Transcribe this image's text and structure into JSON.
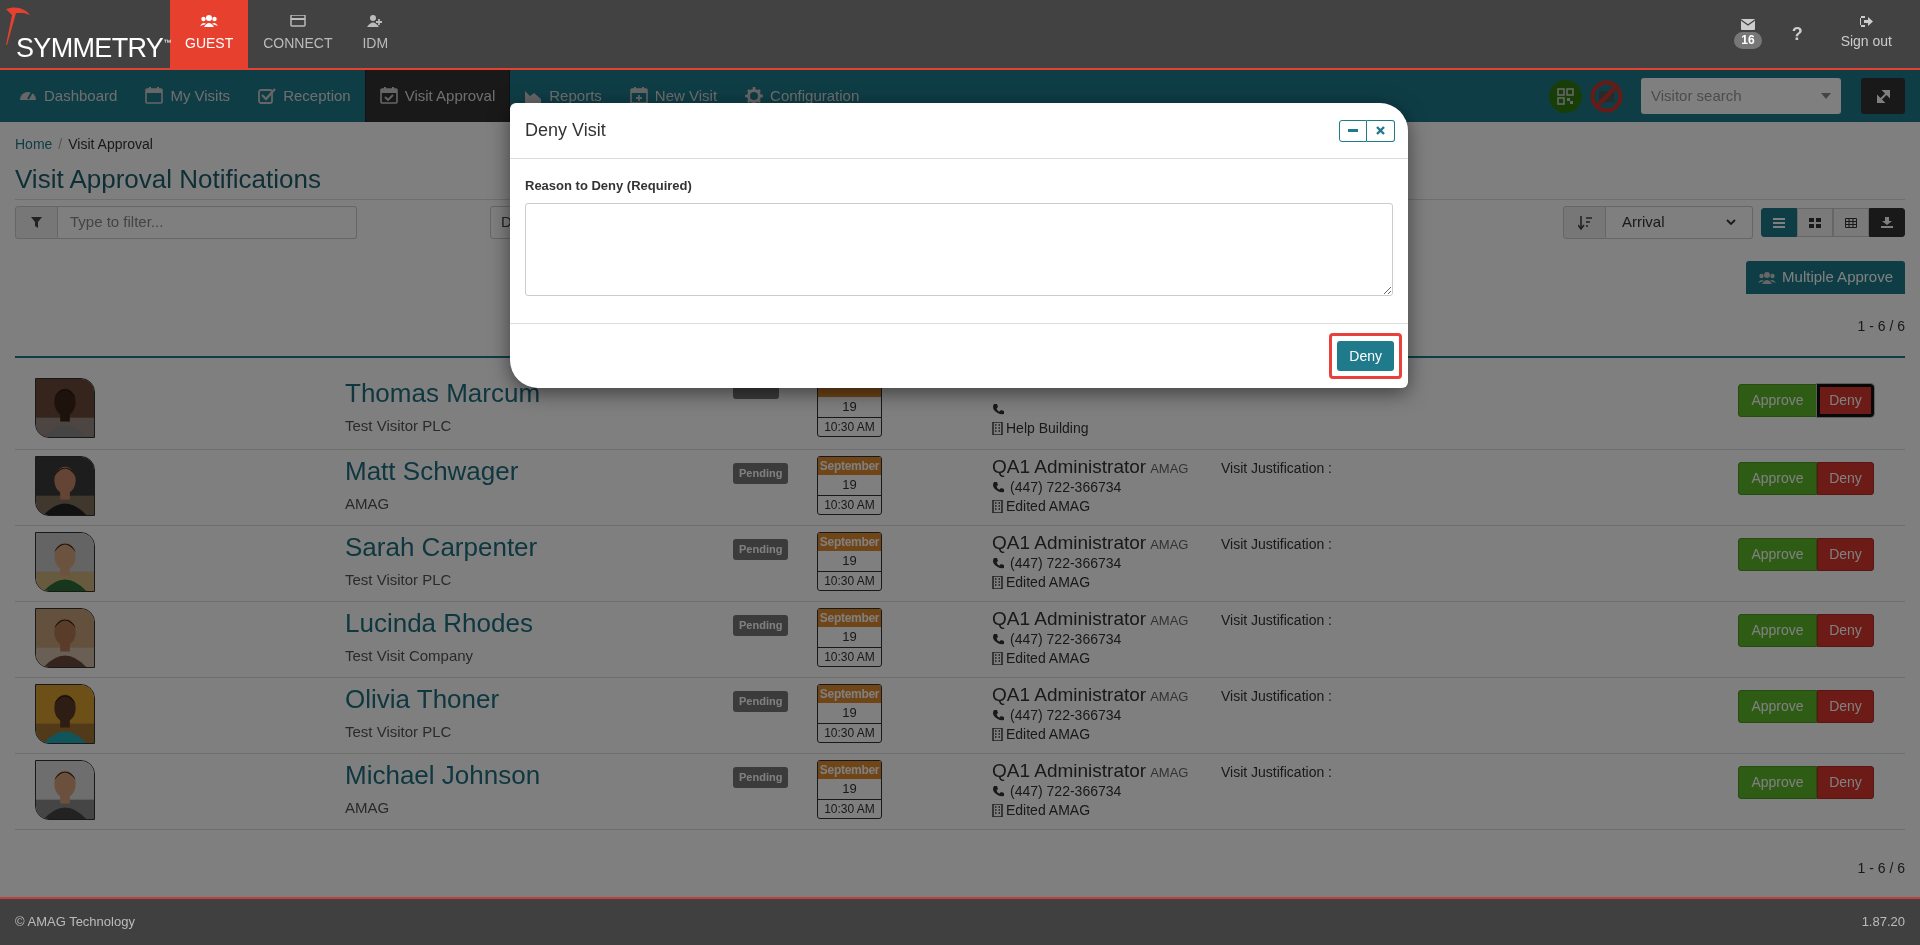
{
  "top_bar": {
    "logo": "SYMMETRY",
    "logo_mark": "™",
    "apps": [
      {
        "label": "GUEST",
        "kind": "guest",
        "selected": true
      },
      {
        "label": "CONNECT",
        "kind": "card",
        "selected": false
      },
      {
        "label": "IDM",
        "kind": "user",
        "selected": false
      }
    ],
    "mail_count": "16",
    "help": "?",
    "sign_out": "Sign out"
  },
  "nav": {
    "items": [
      {
        "label": "Dashboard",
        "kind": "gauge",
        "selected": false
      },
      {
        "label": "My Visits",
        "kind": "calendar",
        "selected": false
      },
      {
        "label": "Reception",
        "kind": "check",
        "selected": false
      },
      {
        "label": "Visit Approval",
        "kind": "calendar-check",
        "selected": true
      },
      {
        "label": "Reports",
        "kind": "chart",
        "selected": false
      },
      {
        "label": "New Visit",
        "kind": "calendar-plus",
        "selected": false
      },
      {
        "label": "Configuration",
        "kind": "gear",
        "selected": false
      }
    ],
    "search_placeholder": "Visitor search"
  },
  "breadcrumb": [
    "Home",
    "Visit Approval"
  ],
  "breadcrumb_separator": "/",
  "title": "Visit Approval Notifications",
  "filter": {
    "placeholder": "Type to filter...",
    "second_control": "D"
  },
  "sort": {
    "value": "Arrival"
  },
  "view_modes": [
    {
      "kind": "list",
      "selected": true
    },
    {
      "kind": "grid",
      "selected": false
    },
    {
      "kind": "table",
      "selected": false
    }
  ],
  "multiple_approve": "Multiple Approve",
  "count_top": "1 - 6 / 6",
  "visits": [
    {
      "name": "Thomas Marcum",
      "company": "Test Visitor PLC",
      "day": "19",
      "time": "10:30 AM",
      "location": "Help Building",
      "approve": "Approve",
      "deny": "Deny",
      "deny_focused": true
    },
    {
      "name": "Matt Schwager",
      "company": "AMAG",
      "status": "Pending",
      "month": "September",
      "day": "19",
      "time": "10:30 AM",
      "host": "QA1 Administrator",
      "host_company": "AMAG",
      "phone": "(447) 722-366734",
      "location": "Edited AMAG",
      "justification": "Visit Justification :",
      "approve": "Approve",
      "deny": "Deny",
      "deny_focused": false
    },
    {
      "name": "Sarah Carpenter",
      "company": "Test Visitor PLC",
      "status": "Pending",
      "month": "September",
      "day": "19",
      "time": "10:30 AM",
      "host": "QA1 Administrator",
      "host_company": "AMAG",
      "phone": "(447) 722-366734",
      "location": "Edited AMAG",
      "justification": "Visit Justification :",
      "approve": "Approve",
      "deny": "Deny",
      "deny_focused": false
    },
    {
      "name": "Lucinda Rhodes",
      "company": "Test Visit Company",
      "status": "Pending",
      "month": "September",
      "day": "19",
      "time": "10:30 AM",
      "host": "QA1 Administrator",
      "host_company": "AMAG",
      "phone": "(447) 722-366734",
      "location": "Edited AMAG",
      "justification": "Visit Justification :",
      "approve": "Approve",
      "deny": "Deny",
      "deny_focused": false
    },
    {
      "name": "Olivia Thoner",
      "company": "Test Visitor PLC",
      "status": "Pending",
      "month": "September",
      "day": "19",
      "time": "10:30 AM",
      "host": "QA1 Administrator",
      "host_company": "AMAG",
      "phone": "(447) 722-366734",
      "location": "Edited AMAG",
      "justification": "Visit Justification :",
      "approve": "Approve",
      "deny": "Deny",
      "deny_focused": false
    },
    {
      "name": "Michael Johnson",
      "company": "AMAG",
      "status": "Pending",
      "month": "September",
      "day": "19",
      "time": "10:30 AM",
      "host": "QA1 Administrator",
      "host_company": "AMAG",
      "phone": "(447) 722-366734",
      "location": "Edited AMAG",
      "justification": "Visit Justification :",
      "approve": "Approve",
      "deny": "Deny",
      "deny_focused": false
    }
  ],
  "count_bottom": "1 - 6 / 6",
  "modal": {
    "title": "Deny Visit",
    "label": "Reason to Deny (Required)",
    "button": "Deny",
    "highlighted": true
  },
  "footer": {
    "copyright": "© AMAG Technology",
    "version": "1.87.20"
  }
}
